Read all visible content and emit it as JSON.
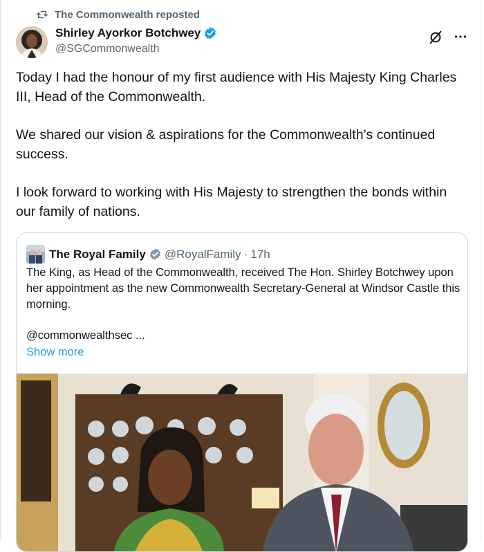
{
  "repost": {
    "label": "The Commonwealth reposted",
    "icon": "repost-icon"
  },
  "author": {
    "name": "Shirley Ayorkor Botchwey",
    "handle": "@SGCommonwealth",
    "verified": true
  },
  "header_icons": [
    "grok-icon",
    "more-icon"
  ],
  "tweet": {
    "paragraphs": [
      "Today I had the honour of my first audience with His Majesty King Charles III, Head of the Commonwealth.",
      "We shared our vision & aspirations for the Commonwealth’s continued success.",
      "I look forward to working with His Majesty to strengthen the bonds within our family of nations."
    ]
  },
  "quote": {
    "name": "The Royal Family",
    "handle": "@RoyalFamily",
    "separator": "·",
    "time": "17h",
    "text": "The King, as Head of the Commonwealth, received The Hon. Shirley Botchwey upon her appointment as the new Commonwealth Secretary-General at Windsor Castle this morning.",
    "mention": "@commonwealthsec ...",
    "show_more": "Show more"
  },
  "colors": {
    "accent": "#1d9bf0",
    "text": "#0f1419",
    "secondary": "#536471",
    "border": "#cfd9de"
  }
}
